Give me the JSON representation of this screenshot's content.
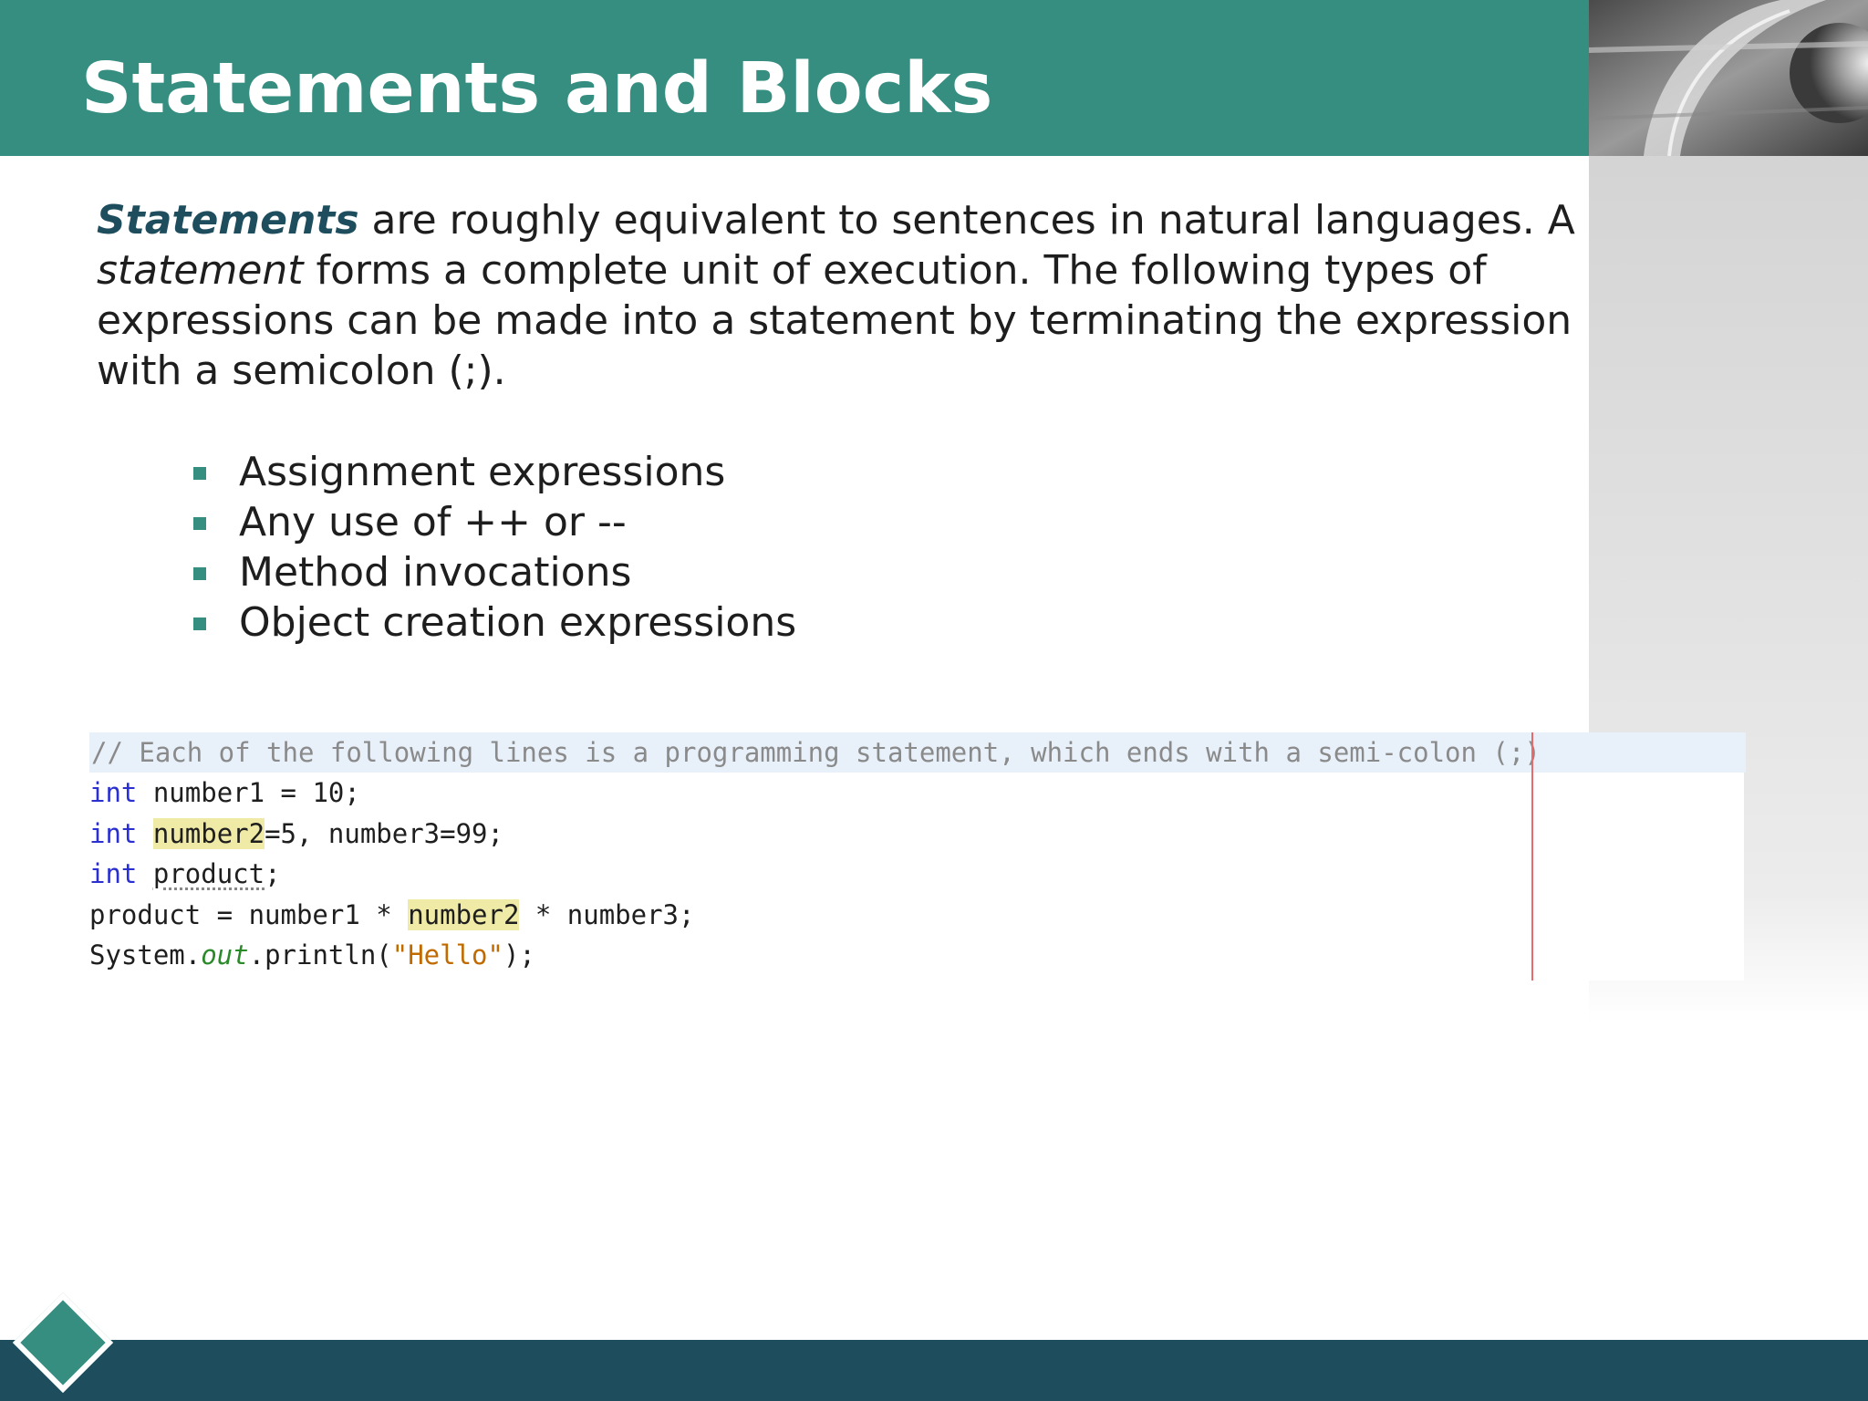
{
  "slide": {
    "title": "Statements and Blocks",
    "intro": {
      "term": "Statements",
      "part1": " are roughly equivalent to sentences in natural languages. A ",
      "term2": "statement",
      "part2": " forms a complete unit of execution. The following types of expressions can be made into a statement by terminating the expression with a semicolon (;)."
    },
    "bullets": [
      "Assignment expressions",
      "Any use of ++ or --",
      "Method invocations",
      "Object creation expressions"
    ]
  },
  "code": {
    "comment": "// Each of the following lines is a programming statement, which ends with a semi-colon (;)",
    "line2": {
      "kw": "int",
      "rest": " number1 = 10;"
    },
    "line3": {
      "kw": "int",
      "hl": "number2",
      "rest": "=5, number3=99;"
    },
    "line4": {
      "kw": "int",
      "name": "product",
      "rest": ";"
    },
    "line5": {
      "pre": "product = number1 * ",
      "hl": "number2",
      "post": " * number3;"
    },
    "line6": {
      "pre": "System.",
      "field": "out",
      "mid": ".println(",
      "str": "\"Hello\"",
      "post": ");"
    }
  },
  "colors": {
    "header": "#358e80",
    "footer": "#1e4d5e",
    "bullet": "#358e80",
    "keyword": "#2a2fd0",
    "string": "#c06a00",
    "field": "#2a8a2a",
    "highlight": "#efeaa6"
  }
}
